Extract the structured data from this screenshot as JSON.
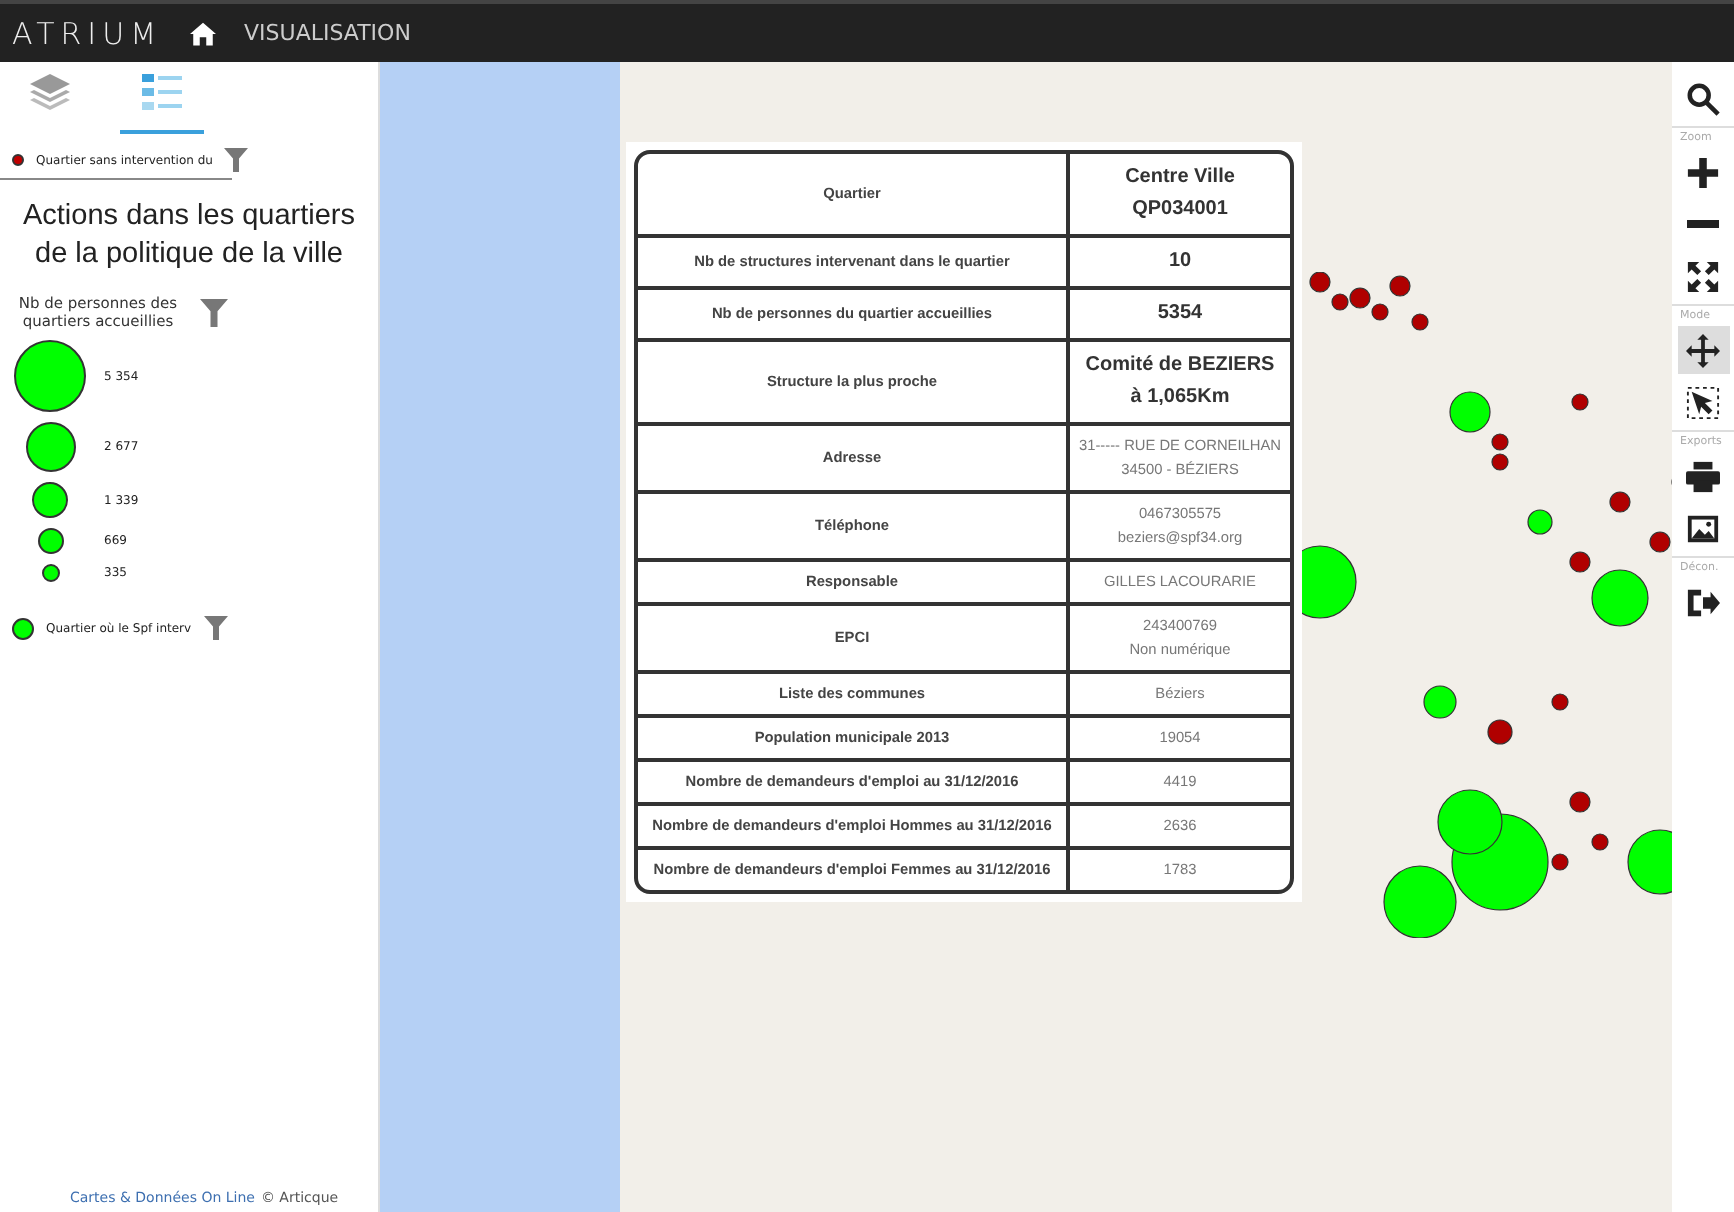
{
  "header": {
    "logo": "ATRIUM",
    "nav": "VISUALISATION"
  },
  "sidebar": {
    "tabs": [
      {
        "kind": "layers",
        "selected": false
      },
      {
        "kind": "legend",
        "selected": true
      }
    ],
    "top_legend": {
      "label": "Quartier sans intervention du",
      "color": "#c00000"
    },
    "title": "Actions dans les quartiers de la politique de la ville",
    "size_legend": {
      "title": "Nb de personnes des quartiers accueillies",
      "color": "#00ff00",
      "entries": [
        "5 354",
        "2 677",
        "1 339",
        "669",
        "335"
      ]
    },
    "bottom_legend": {
      "label": "Quartier où le Spf interv",
      "color": "#00ff00"
    },
    "footer": {
      "link": "Cartes & Données On Line",
      "credit": "© Articque"
    }
  },
  "popup": {
    "rows": [
      {
        "label": "Quartier",
        "values": [
          "Centre Ville",
          "QP034001"
        ],
        "emphasis": true
      },
      {
        "label": "Nb de structures intervenant dans le quartier",
        "values": [
          "10"
        ],
        "emphasis": true
      },
      {
        "label": "Nb de personnes du quartier accueillies",
        "values": [
          "5354"
        ],
        "emphasis": true
      },
      {
        "label": "Structure la plus proche",
        "values": [
          "Comité de BEZIERS",
          "à 1,065Km"
        ],
        "emphasis": true
      },
      {
        "label": "Adresse",
        "values": [
          "31----- RUE DE CORNEILHAN",
          "34500 - BÉZIERS"
        ],
        "emphasis": false
      },
      {
        "label": "Téléphone",
        "values": [
          "0467305575",
          "beziers@spf34.org"
        ],
        "emphasis": false
      },
      {
        "label": "Responsable",
        "values": [
          "GILLES LACOURARIE"
        ],
        "emphasis": false
      },
      {
        "label": "EPCI",
        "values": [
          "243400769",
          "Non numérique"
        ],
        "emphasis": false
      },
      {
        "label": "Liste des communes",
        "values": [
          "Béziers"
        ],
        "emphasis": false
      },
      {
        "label": "Population municipale 2013",
        "values": [
          "19054"
        ],
        "emphasis": false
      },
      {
        "label": "Nombre de demandeurs d'emploi au 31/12/2016",
        "values": [
          "4419"
        ],
        "emphasis": false
      },
      {
        "label": "Nombre de demandeurs d'emploi Hommes au 31/12/2016",
        "values": [
          "2636"
        ],
        "emphasis": false
      },
      {
        "label": "Nombre de demandeurs d'emploi Femmes au 31/12/2016",
        "values": [
          "1783"
        ],
        "emphasis": false
      }
    ]
  },
  "toolbar": {
    "groups": [
      {
        "tools": [
          {
            "kind": "search",
            "selected": false
          }
        ]
      },
      {
        "label": "Zoom",
        "tools": [
          {
            "kind": "zoom-in",
            "selected": false
          },
          {
            "kind": "zoom-out",
            "selected": false
          },
          {
            "kind": "fullscreen",
            "selected": false
          }
        ]
      },
      {
        "label": "Mode",
        "tools": [
          {
            "kind": "pan",
            "selected": true
          },
          {
            "kind": "select",
            "selected": false
          }
        ]
      },
      {
        "label": "Exports",
        "tools": [
          {
            "kind": "print",
            "selected": false
          },
          {
            "kind": "image",
            "selected": false
          }
        ]
      },
      {
        "label": "Décon.",
        "tools": [
          {
            "kind": "logout",
            "selected": false
          }
        ]
      }
    ]
  }
}
